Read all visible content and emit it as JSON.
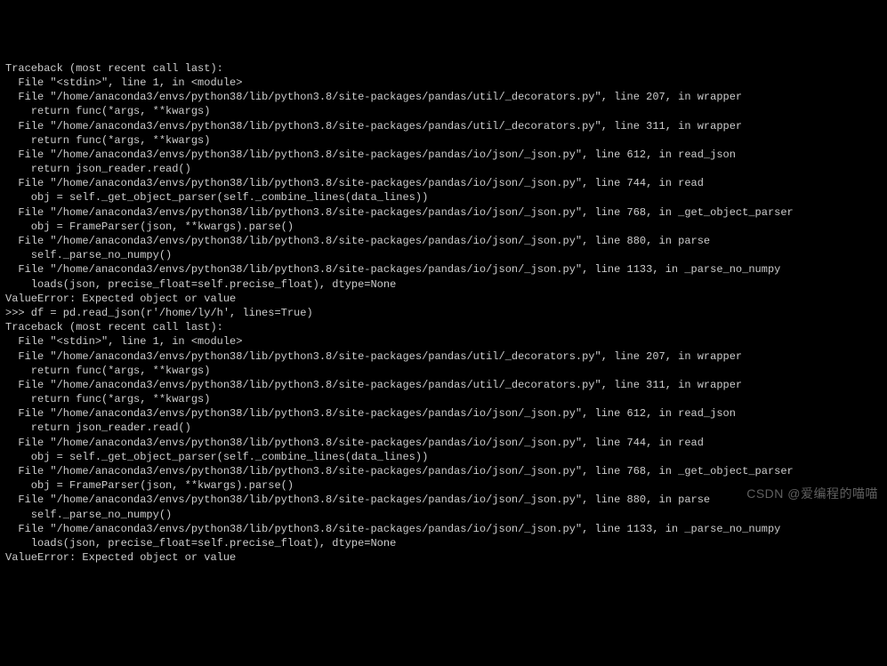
{
  "traceback1": {
    "header": "Traceback (most recent call last):",
    "frames": [
      {
        "loc": "  File \"<stdin>\", line 1, in <module>",
        "code": null
      },
      {
        "loc": "  File \"/home/anaconda3/envs/python38/lib/python3.8/site-packages/pandas/util/_decorators.py\", line 207, in wrapper",
        "code": "    return func(*args, **kwargs)"
      },
      {
        "loc": "  File \"/home/anaconda3/envs/python38/lib/python3.8/site-packages/pandas/util/_decorators.py\", line 311, in wrapper",
        "code": "    return func(*args, **kwargs)"
      },
      {
        "loc": "  File \"/home/anaconda3/envs/python38/lib/python3.8/site-packages/pandas/io/json/_json.py\", line 612, in read_json",
        "code": "    return json_reader.read()"
      },
      {
        "loc": "  File \"/home/anaconda3/envs/python38/lib/python3.8/site-packages/pandas/io/json/_json.py\", line 744, in read",
        "code": "    obj = self._get_object_parser(self._combine_lines(data_lines))"
      },
      {
        "loc": "  File \"/home/anaconda3/envs/python38/lib/python3.8/site-packages/pandas/io/json/_json.py\", line 768, in _get_object_parser",
        "code": "    obj = FrameParser(json, **kwargs).parse()"
      },
      {
        "loc": "  File \"/home/anaconda3/envs/python38/lib/python3.8/site-packages/pandas/io/json/_json.py\", line 880, in parse",
        "code": "    self._parse_no_numpy()"
      },
      {
        "loc": "  File \"/home/anaconda3/envs/python38/lib/python3.8/site-packages/pandas/io/json/_json.py\", line 1133, in _parse_no_numpy",
        "code": "    loads(json, precise_float=self.precise_float), dtype=None"
      }
    ],
    "error": "ValueError: Expected object or value"
  },
  "input_line": ">>> df = pd.read_json(r'/home/ly/h', lines=True)",
  "traceback2": {
    "header": "Traceback (most recent call last):",
    "frames": [
      {
        "loc": "  File \"<stdin>\", line 1, in <module>",
        "code": null
      },
      {
        "loc": "  File \"/home/anaconda3/envs/python38/lib/python3.8/site-packages/pandas/util/_decorators.py\", line 207, in wrapper",
        "code": "    return func(*args, **kwargs)"
      },
      {
        "loc": "  File \"/home/anaconda3/envs/python38/lib/python3.8/site-packages/pandas/util/_decorators.py\", line 311, in wrapper",
        "code": "    return func(*args, **kwargs)"
      },
      {
        "loc": "  File \"/home/anaconda3/envs/python38/lib/python3.8/site-packages/pandas/io/json/_json.py\", line 612, in read_json",
        "code": "    return json_reader.read()"
      },
      {
        "loc": "  File \"/home/anaconda3/envs/python38/lib/python3.8/site-packages/pandas/io/json/_json.py\", line 744, in read",
        "code": "    obj = self._get_object_parser(self._combine_lines(data_lines))"
      },
      {
        "loc": "  File \"/home/anaconda3/envs/python38/lib/python3.8/site-packages/pandas/io/json/_json.py\", line 768, in _get_object_parser",
        "code": "    obj = FrameParser(json, **kwargs).parse()"
      },
      {
        "loc": "  File \"/home/anaconda3/envs/python38/lib/python3.8/site-packages/pandas/io/json/_json.py\", line 880, in parse",
        "code": "    self._parse_no_numpy()"
      },
      {
        "loc": "  File \"/home/anaconda3/envs/python38/lib/python3.8/site-packages/pandas/io/json/_json.py\", line 1133, in _parse_no_numpy",
        "code": "    loads(json, precise_float=self.precise_float), dtype=None"
      }
    ],
    "error": "ValueError: Expected object or value"
  },
  "watermark": "CSDN @爱编程的喵喵"
}
